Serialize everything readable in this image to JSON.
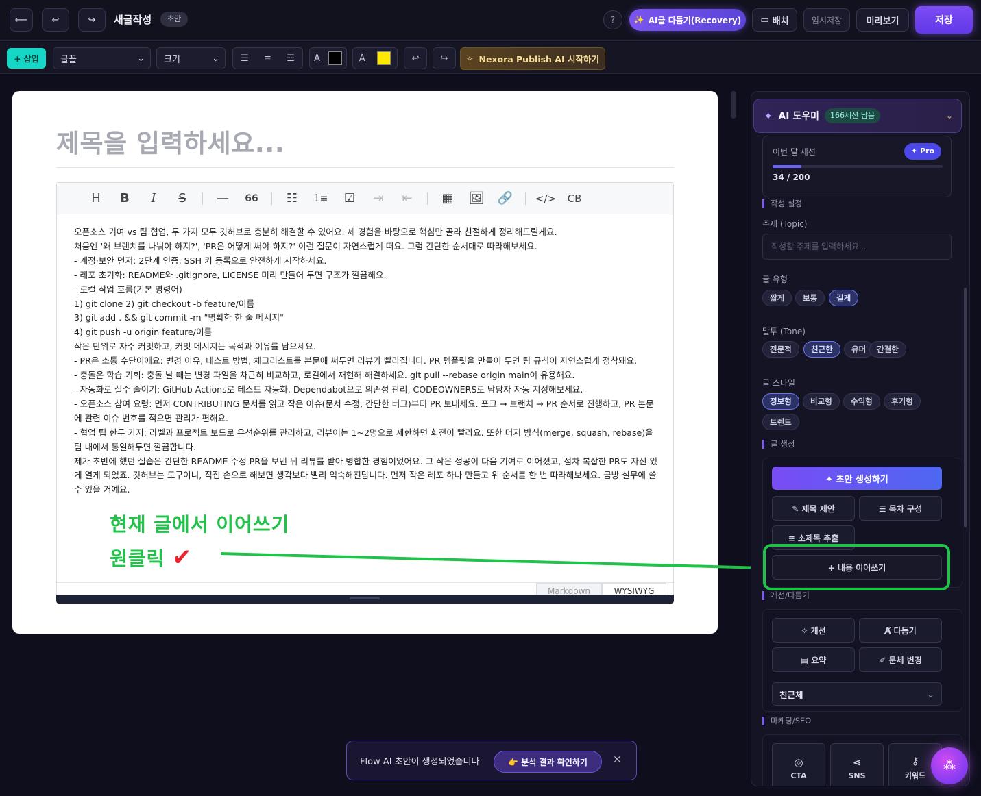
{
  "header": {
    "back_icon": "arrow-left-icon",
    "undo_icon": "undo-icon",
    "redo_icon": "redo-icon",
    "title": "새글작성",
    "badge": "초안",
    "help": "?",
    "ai_polish": "AI글 다듬기(Recovery)",
    "layout": "배치",
    "temp_save": "임시저장",
    "preview": "미리보기",
    "save": "저장"
  },
  "toolbar": {
    "insert": "+ 삽입",
    "font": "글꼴",
    "size": "크기",
    "text_color_label": "A",
    "text_color": "#000000",
    "highlight_label": "A",
    "highlight_color": "#ffea00",
    "nexora": "Nexora Publish AI 시작하기"
  },
  "editor": {
    "title_placeholder": "제목을 입력하세요...",
    "tools": [
      "H",
      "B",
      "I",
      "S",
      "—",
      "66",
      "list",
      "ordered-list",
      "task",
      "indent",
      "outdent",
      "table",
      "image",
      "link",
      "code",
      "CB"
    ],
    "body": [
      "오픈소스 기여 vs 팀 협업, 두 가지 모두 깃허브로 충분히 해결할 수 있어요. 제 경험을 바탕으로 핵심만 골라 친절하게 정리해드릴게요.",
      "처음엔 '왜 브랜치를 나눠야 하지?', 'PR은 어떻게 써야 하지?' 이런 질문이 자연스럽게 떠요. 그럼 간단한 순서대로 따라해보세요.",
      "- 계정·보안 먼저: 2단계 인증, SSH 키 등록으로 안전하게 시작하세요.",
      "- 레포 초기화: README와 .gitignore, LICENSE 미리 만들어 두면 구조가 깔끔해요.",
      "- 로컬 작업 흐름(기본 명령어)",
      "1) git clone 2) git checkout -b feature/이름",
      "3) git add . && git commit -m \"명확한 한 줄 메시지\"",
      "4) git push -u origin feature/이름",
      "작은 단위로 자주 커밋하고, 커밋 메시지는 목적과 이유를 담으세요.",
      "- PR은 소통 수단이에요: 변경 이유, 테스트 방법, 체크리스트를 본문에 써두면 리뷰가 빨라집니다. PR 템플릿을 만들어 두면 팀 규칙이 자연스럽게 정착돼요.",
      "- 충돌은 학습 기회: 충돌 날 때는 변경 파일을 차근히 비교하고, 로컬에서 재현해 해결하세요. git pull --rebase origin main이 유용해요.",
      "- 자동화로 실수 줄이기: GitHub Actions로 테스트 자동화, Dependabot으로 의존성 관리, CODEOWNERS로 담당자 자동 지정해보세요.",
      "- 오픈소스 참여 요령: 먼저 CONTRIBUTING 문서를 읽고 작은 이슈(문서 수정, 간단한 버그)부터 PR 보내세요. 포크 → 브랜치 → PR 순서로 진행하고, PR 본문에 관련 이슈 번호를 적으면 관리가 편해요.",
      "- 협업 팁 한두 가지: 라벨과 프로젝트 보드로 우선순위를 관리하고, 리뷰어는 1~2명으로 제한하면 회전이 빨라요. 또한 머지 방식(merge, squash, rebase)을 팀 내에서 통일해두면 깔끔합니다.",
      "제가 초반에 했던 실습은 간단한 README 수정 PR을 보낸 뒤 리뷰를 받아 병합한 경험이었어요. 그 작은 성공이 다음 기여로 이어졌고, 점차 복잡한 PR도 자신 있게 열게 되었죠. 깃허브는 도구이니, 직접 손으로 해보면 생각보다 빨리 익숙해진답니다. 먼저 작은 레포 하나 만들고 위 순서를 한 번 따라해보세요. 금방 실무에 쓸 수 있을 거예요."
    ],
    "mode_markdown": "Markdown",
    "mode_wysiwyg": "WYSIWYG"
  },
  "annotation": {
    "line1": "현재 글에서 이어쓰기",
    "line2": "원클릭",
    "color": "#21c24a"
  },
  "panel": {
    "title": "AI 도우미",
    "sessions_badge": "166세션 남음",
    "month_sessions_label": "이번 달 세션",
    "pro": "✦ Pro",
    "usage_text": "34 / 200",
    "usage_fraction": 0.17,
    "section_settings": "작성 설정",
    "topic_label": "주제 (Topic)",
    "topic_placeholder": "작성할 주제를 입력하세요...",
    "type_label": "글 유형",
    "types": [
      "짧게",
      "보통",
      "길게"
    ],
    "tone_label": "말투 (Tone)",
    "tones": [
      "전문적",
      "친근한",
      "유머",
      "간결한"
    ],
    "style_label": "글 스타일",
    "styles": [
      "정보형",
      "비교형",
      "수익형",
      "후기형",
      "트렌드"
    ],
    "section_generate": "글 생성",
    "draft_btn": "초안 생성하기",
    "title_suggest": "제목 제안",
    "toc": "목차 구성",
    "subheading": "소제목 추출",
    "continue": "+ 내용 이어쓰기",
    "section_improve": "개선/다듬기",
    "improve": "개선",
    "polish": "다듬기",
    "summary": "요약",
    "style_change": "문체 변경",
    "tone_select": "친근체",
    "section_marketing": "마케팅/SEO",
    "cta": "CTA",
    "sns": "SNS",
    "keyword": "키워드"
  },
  "toast": {
    "message": "Flow AI 초안이 생성되었습니다",
    "action": "👉 분석 결과 확인하기",
    "close": "×"
  }
}
